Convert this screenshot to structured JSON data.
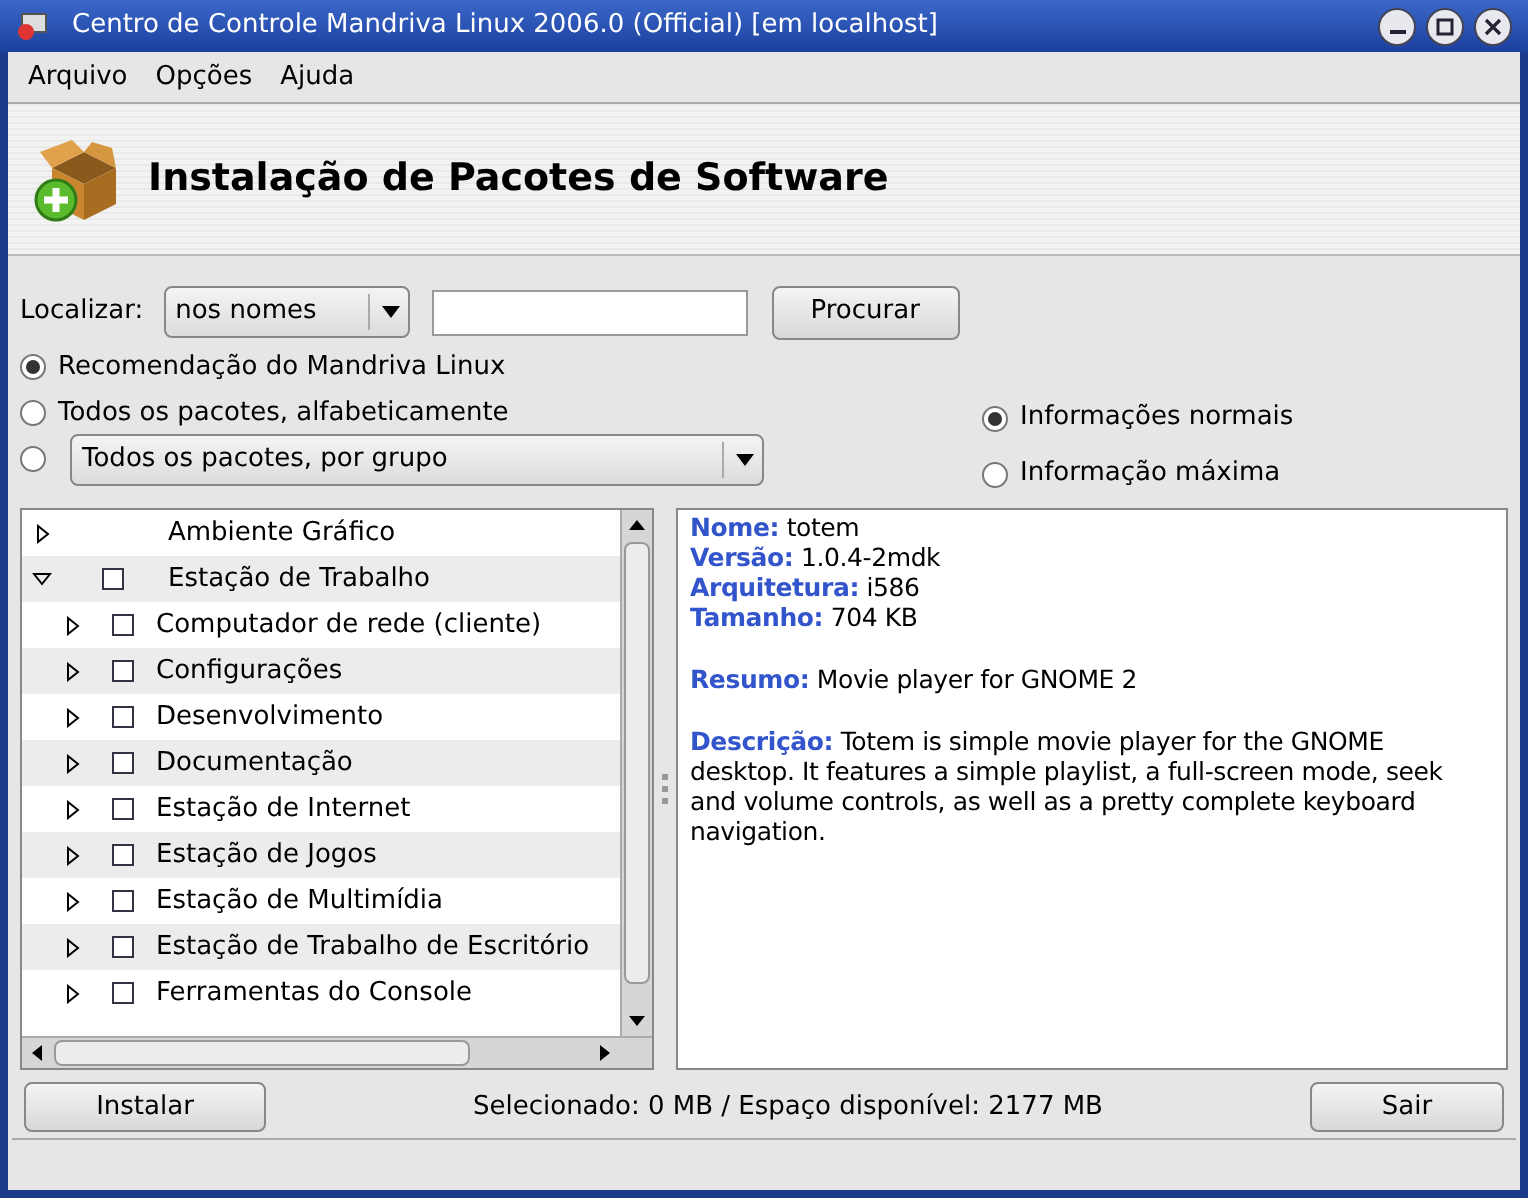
{
  "window": {
    "title": "Centro de Controle Mandriva Linux 2006.0 (Official) [em localhost]"
  },
  "menu": [
    {
      "label": "Arquivo"
    },
    {
      "label": "Opções"
    },
    {
      "label": "Ajuda"
    }
  ],
  "header": {
    "title": "Instalação de Pacotes de Software"
  },
  "search": {
    "label": "Localizar:",
    "mode": "nos nomes",
    "button": "Procurar"
  },
  "view_options": [
    {
      "label": "Recomendação do Mandriva Linux",
      "selected": true,
      "kind": "text"
    },
    {
      "label": "Todos os pacotes, alfabeticamente",
      "selected": false,
      "kind": "text"
    },
    {
      "label": "Todos os pacotes, por grupo",
      "selected": false,
      "kind": "combo"
    }
  ],
  "info_options": [
    {
      "label": "Informações normais",
      "selected": true
    },
    {
      "label": "Informação máxima",
      "selected": false
    }
  ],
  "tree": [
    {
      "label": "Ambiente Gráfico",
      "kind": "plain",
      "expanded": false
    },
    {
      "label": "Estação de Trabalho",
      "kind": "checkbox",
      "checked": false,
      "expanded": true,
      "children": [
        {
          "label": "Computador de rede (cliente)",
          "kind": "checkbox",
          "checked": false,
          "expanded": false
        },
        {
          "label": "Configurações",
          "kind": "checkbox",
          "checked": false,
          "expanded": false
        },
        {
          "label": "Desenvolvimento",
          "kind": "checkbox",
          "checked": false,
          "expanded": false
        },
        {
          "label": "Documentação",
          "kind": "checkbox",
          "checked": false,
          "expanded": false
        },
        {
          "label": "Estação de Internet",
          "kind": "checkbox",
          "checked": false,
          "expanded": false
        },
        {
          "label": "Estação de Jogos",
          "kind": "checkbox",
          "checked": false,
          "expanded": false
        },
        {
          "label": "Estação de Multimídia",
          "kind": "checkbox",
          "checked": false,
          "expanded": false
        },
        {
          "label": "Estação de Trabalho de Escritório",
          "kind": "checkbox",
          "checked": false,
          "expanded": false
        },
        {
          "label": "Ferramentas do Console",
          "kind": "checkbox",
          "checked": false,
          "expanded": false
        }
      ]
    }
  ],
  "details": {
    "fields": [
      "**Nome:** totem",
      "**Versão:** 1.0.4-2mdk",
      "**Arquitetura:** i586",
      "**Tamanho:** 704 KB"
    ],
    "summary": "**Resumo:** Movie player for GNOME 2",
    "description": "**Descrição:** Totem is simple movie player for the GNOME desktop. It features a simple playlist, a full-screen mode, seek and volume controls, as well as a pretty complete keyboard navigation."
  },
  "footer": {
    "install": "Instalar",
    "status": "Selecionado: 0 MB / Espaço disponível: 2177 MB",
    "quit": "Sair"
  }
}
